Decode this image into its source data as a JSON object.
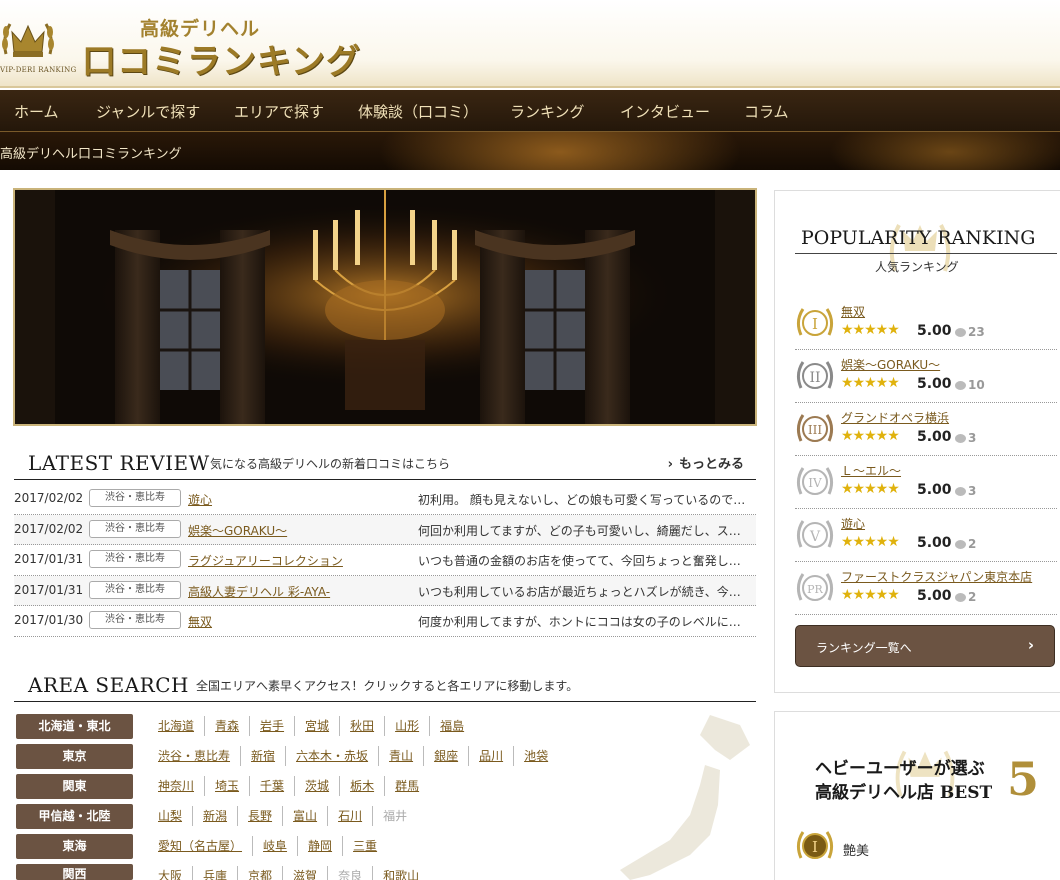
{
  "header": {
    "logo_line1": "高級デリヘル",
    "logo_line2": "口コミランキング",
    "logo_sub": "VIP-DERI RANKING"
  },
  "nav": {
    "items": [
      "ホーム",
      "ジャンルで探す",
      "エリアで探す",
      "体験談（口コミ）",
      "ランキング",
      "インタビュー",
      "コラム"
    ]
  },
  "breadcrumb": "高級デリヘル口コミランキング",
  "latest_review": {
    "title": "LATEST REVIEW",
    "subtitle": "気になる高級デリヘルの新着口コミはこちら",
    "more": "もっとみる",
    "rows": [
      {
        "date": "2017/02/02",
        "area": "渋谷・恵比寿",
        "shop": "遊心",
        "text": "初利用。 顔も見えないし、どの娘も可愛く写っているので…"
      },
      {
        "date": "2017/02/02",
        "area": "渋谷・恵比寿",
        "shop": "娯楽～GORAKU～",
        "text": "何回か利用してますが、どの子も可愛いし、綺麗だし、ス…"
      },
      {
        "date": "2017/01/31",
        "area": "渋谷・恵比寿",
        "shop": "ラグジュアリーコレクション",
        "text": "いつも普通の金額のお店を使ってて、今回ちょっと奮発し…"
      },
      {
        "date": "2017/01/31",
        "area": "渋谷・恵比寿",
        "shop": "高級人妻デリヘル 彩-AYA-",
        "text": "いつも利用しているお店が最近ちょっとハズレが続き、今…"
      },
      {
        "date": "2017/01/30",
        "area": "渋谷・恵比寿",
        "shop": "無双",
        "text": "何度か利用してますが、ホントにココは女の子のレベルに…"
      }
    ]
  },
  "area_search": {
    "title": "AREA SEARCH",
    "subtitle": "全国エリアへ素早くアクセス！クリックすると各エリアに移動します。",
    "regions": [
      {
        "name": "北海道・東北",
        "prefs": [
          "北海道",
          "青森",
          "岩手",
          "宮城",
          "秋田",
          "山形",
          "福島"
        ],
        "disabled": []
      },
      {
        "name": "東京",
        "prefs": [
          "渋谷・恵比寿",
          "新宿",
          "六本木・赤坂",
          "青山",
          "銀座",
          "品川",
          "池袋"
        ],
        "disabled": []
      },
      {
        "name": "関東",
        "prefs": [
          "神奈川",
          "埼玉",
          "千葉",
          "茨城",
          "栃木",
          "群馬"
        ],
        "disabled": []
      },
      {
        "name": "甲信越・北陸",
        "prefs": [
          "山梨",
          "新潟",
          "長野",
          "富山",
          "石川",
          "福井"
        ],
        "disabled": [
          "福井"
        ]
      },
      {
        "name": "東海",
        "prefs": [
          "愛知（名古屋）",
          "岐阜",
          "静岡",
          "三重"
        ],
        "disabled": []
      },
      {
        "name": "関西",
        "prefs": [
          "大阪",
          "兵庫",
          "京都",
          "滋賀",
          "奈良",
          "和歌山"
        ],
        "disabled": [
          "奈良"
        ]
      }
    ]
  },
  "popularity": {
    "title": "POPULARITY RANKING",
    "subtitle": "人気ランキング",
    "items": [
      {
        "rank": "I",
        "name": "無双",
        "stars": "★★★★★",
        "score": "5.00",
        "comments": "23",
        "color": "#c9a43a"
      },
      {
        "rank": "II",
        "name": "娯楽～GORAKU～",
        "stars": "★★★★★",
        "score": "5.00",
        "comments": "10",
        "color": "#8a8a8a"
      },
      {
        "rank": "III",
        "name": "グランドオペラ横浜",
        "stars": "★★★★★",
        "score": "5.00",
        "comments": "3",
        "color": "#9c7a52"
      },
      {
        "rank": "IV",
        "name": "Ｌ～エル～",
        "stars": "★★★★★",
        "score": "5.00",
        "comments": "3",
        "color": "#b5b5b5"
      },
      {
        "rank": "V",
        "name": "遊心",
        "stars": "★★★★★",
        "score": "5.00",
        "comments": "2",
        "color": "#b5b5b5"
      },
      {
        "rank": "PR",
        "name": "ファーストクラスジャパン東京本店",
        "stars": "★★★★★",
        "score": "5.00",
        "comments": "2",
        "color": "#b5b5b5"
      }
    ],
    "all_button": "ランキング一覧へ"
  },
  "best5": {
    "title_line1": "ヘビーユーザーが選ぶ",
    "title_line2": "高級デリヘル店 BEST",
    "number": "5",
    "first_item": {
      "rank": "I",
      "name": "艶美"
    }
  },
  "colors": {
    "accent_brown": "#6b5342",
    "gold": "#c9a43a",
    "link": "#7a5a1e",
    "nav_bg": "#2e1e0e"
  }
}
